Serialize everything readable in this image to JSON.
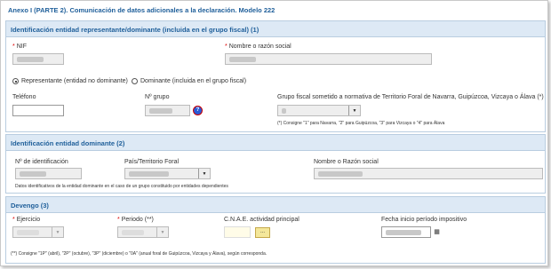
{
  "title": "Anexo I (PARTE 2). Comunicación de datos adicionales a la declaración. Modelo 222",
  "section1": {
    "heading": "Identificación entidad representante/dominante (incluida en el grupo fiscal) (1)",
    "nif_label": "NIF",
    "nombre_label": "Nombre o razón social",
    "radio_representante": "Representante (entidad no dominante)",
    "radio_dominante": "Dominante (incluida en el grupo fiscal)",
    "telefono_label": "Teléfono",
    "ngrupo_label": "Nº grupo",
    "grupo_fiscal_label": "Grupo fiscal sometido a normativa de Territorio Foral de Navarra, Guipúzcoa, Vizcaya o Álava (*)",
    "grupo_fiscal_note": "(*) Consigne \"1\" para Navarra, \"2\" para Guipúzcoa, \"3\" para Vizcaya o \"4\" para Álava",
    "help_icon": "?"
  },
  "section2": {
    "heading": "Identificación entidad dominante (2)",
    "nident_label": "Nº de identificación",
    "pais_label": "País/Territorio Foral",
    "nombre_label": "Nombre o Razón social",
    "note": "Datos identificativos de la entidad dominante en el caso de un grupo constituido por entidades dependientes"
  },
  "section3": {
    "heading": "Devengo (3)",
    "ejercicio_label": "Ejercicio",
    "periodo_label": "Periodo (**)",
    "cnae_label": "C.N.A.E. actividad principal",
    "fecha_label": "Fecha inicio período impositivo",
    "dots_label": "...",
    "note": "(**) Consigne \"1P\" (abril), \"2P\" (octubre), \"3P\" (diciembre) o \"0A\" (anual foral de Guipúzcoa, Vizcaya y Álava), según corresponda."
  },
  "required_mark": "*",
  "icons": {
    "dropdown": "chevron-down-icon",
    "calendar": "calendar-icon",
    "help": "help-icon"
  }
}
